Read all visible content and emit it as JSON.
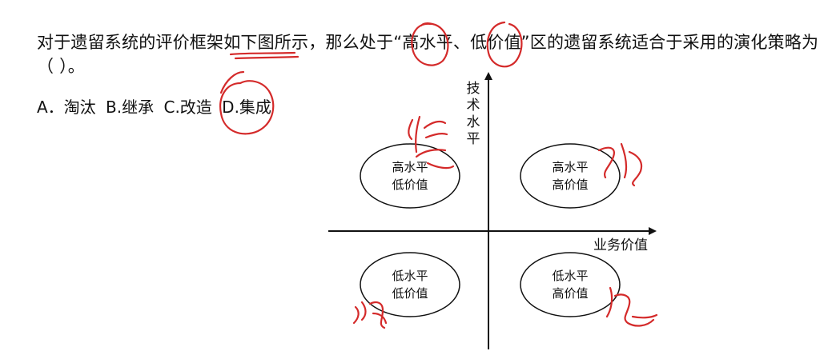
{
  "question": {
    "text": "对于遗留系统的评价框架如下图所示，那么处于“高水平、低价值”区的遗留系统适合于采用的演化策略为（ ）。"
  },
  "options": [
    {
      "text": "A．淘汰"
    },
    {
      "text": "B.继承"
    },
    {
      "text": "C.改造"
    },
    {
      "text": "D.集成"
    }
  ],
  "diagram": {
    "y_axis_label": [
      "技",
      "术",
      "水",
      "平"
    ],
    "x_axis_label": "业务价值",
    "quadrants": [
      {
        "line1": "高水平",
        "line2": "低价值"
      },
      {
        "line1": "高水平",
        "line2": "高价值"
      },
      {
        "line1": "低水平",
        "line2": "低价值"
      },
      {
        "line1": "低水平",
        "line2": "高价值"
      }
    ]
  },
  "colors": {
    "text": "#111111",
    "annotation": "#d42a2a"
  }
}
